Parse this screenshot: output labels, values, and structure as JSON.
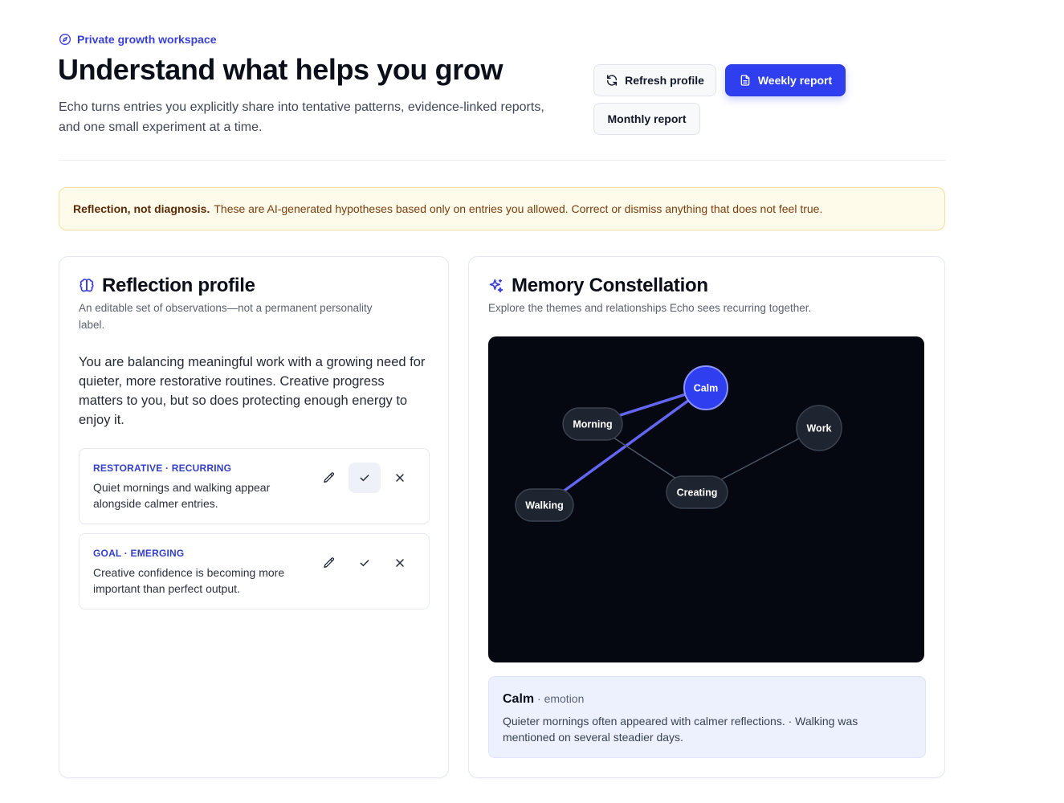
{
  "header": {
    "eyebrow": "Private growth workspace",
    "title": "Understand what helps you grow",
    "lede": "Echo turns entries you explicitly share into tentative patterns, evidence-linked reports, and one small experiment at a time."
  },
  "actions": {
    "refresh": "Refresh profile",
    "weekly": "Weekly report",
    "monthly": "Monthly report"
  },
  "notice": {
    "strong": "Reflection, not diagnosis.",
    "text": "These are AI-generated hypotheses based only on entries you allowed. Correct or dismiss anything that does not feel true."
  },
  "profile": {
    "title": "Reflection profile",
    "subtitle": "An editable set of observations—not a permanent personality label.",
    "summary": "You are balancing meaningful work with a growing need for quieter, more restorative routines. Creative progress matters to you, but so does protecting enough energy to enjoy it.",
    "observations": [
      {
        "tag": "RESTORATIVE · RECURRING",
        "text": "Quiet mornings and walking appear alongside calmer entries.",
        "confirmed": true
      },
      {
        "tag": "GOAL · EMERGING",
        "text": "Creative confidence is becoming more important than perfect output.",
        "confirmed": false
      }
    ]
  },
  "memory": {
    "title": "Memory Constellation",
    "subtitle": "Explore the themes and relationships Echo sees recurring together.",
    "nodes": [
      {
        "id": "calm",
        "label": "Calm",
        "selected": true
      },
      {
        "id": "morning",
        "label": "Morning",
        "selected": false
      },
      {
        "id": "work",
        "label": "Work",
        "selected": false
      },
      {
        "id": "creating",
        "label": "Creating",
        "selected": false
      },
      {
        "id": "walking",
        "label": "Walking",
        "selected": false
      }
    ],
    "edges": [
      {
        "from": "calm",
        "to": "morning",
        "highlight": true
      },
      {
        "from": "calm",
        "to": "walking",
        "highlight": true
      },
      {
        "from": "morning",
        "to": "creating",
        "highlight": false
      },
      {
        "from": "creating",
        "to": "work",
        "highlight": false
      }
    ],
    "detail": {
      "name": "Calm",
      "kind": " · emotion",
      "body": "Quieter mornings often appeared with calmer reflections. · Walking was mentioned on several steadier days."
    }
  },
  "colors": {
    "accent": "#2f3ff0",
    "edge_highlight": "#6366f1",
    "edge_dim": "#4b5563",
    "node_fill": "#1f2530",
    "canvas": "#050810"
  }
}
